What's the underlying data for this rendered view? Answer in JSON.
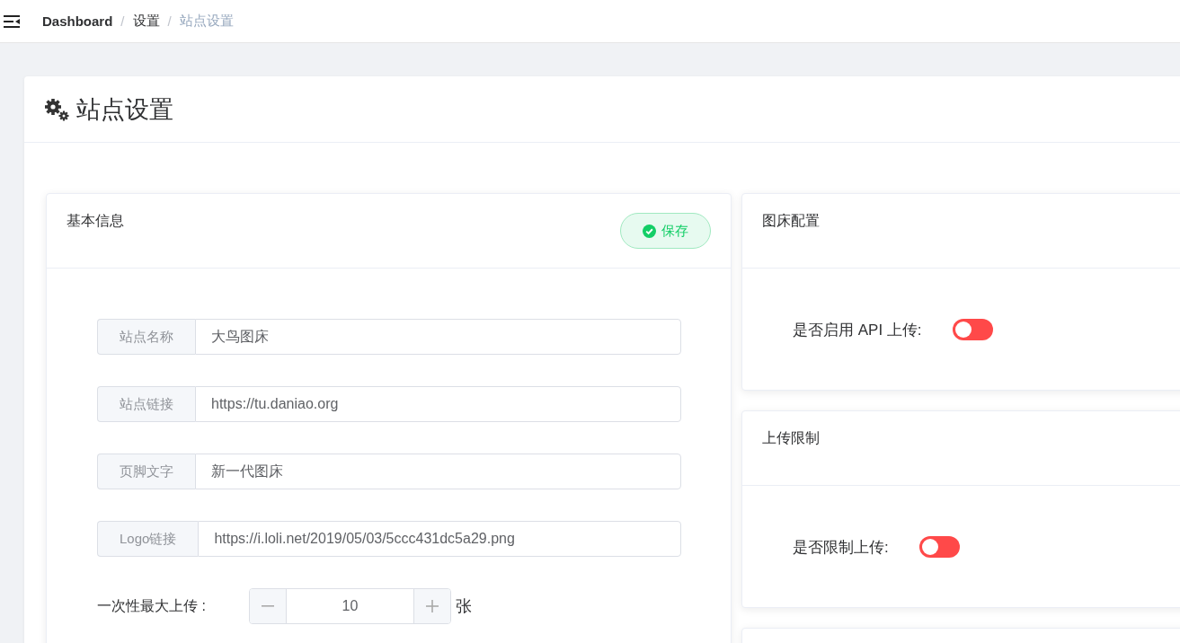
{
  "breadcrumb": {
    "separator": "/",
    "items": [
      {
        "label": "Dashboard",
        "current": false,
        "bold": true
      },
      {
        "label": "设置",
        "current": false,
        "bold": false
      },
      {
        "label": "站点设置",
        "current": true,
        "bold": false
      }
    ]
  },
  "page": {
    "title": "站点设置"
  },
  "basic": {
    "title": "基本信息",
    "save_button": "保存",
    "fields": [
      {
        "label": "站点名称",
        "value": "大鸟图床"
      },
      {
        "label": "站点链接",
        "value": "https://tu.daniao.org"
      },
      {
        "label": "页脚文字",
        "value": "新一代图床"
      },
      {
        "label": "Logo链接",
        "value": "https://i.loli.net/2019/05/03/5ccc431dc5a29.png"
      }
    ],
    "max_upload": {
      "label": "一次性最大上传 :",
      "value": "10",
      "unit": "张"
    }
  },
  "panels": [
    {
      "title": "图床配置",
      "switch": {
        "label": "是否启用 API 上传:",
        "on": false
      }
    },
    {
      "title": "上传限制",
      "switch": {
        "label": "是否限制上传:",
        "on": false
      }
    }
  ]
}
